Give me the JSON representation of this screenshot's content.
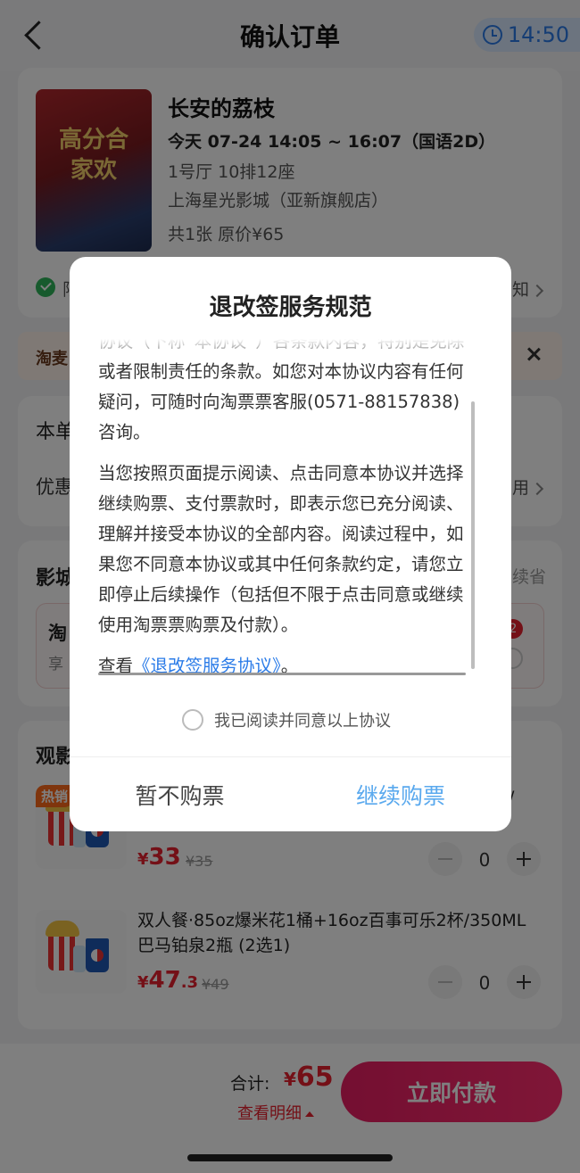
{
  "header": {
    "title": "确认订单",
    "timer": "14:50"
  },
  "movie": {
    "poster_text": "高分合家欢",
    "title": "长安的荔枝",
    "showtime": "今天 07-24 14:05 ~ 16:07（国语2D）",
    "seat": "1号厅 10排12座",
    "cinema": "上海星光影城（亚新旗舰店）",
    "ticket_summary": "共1张  原价¥65",
    "policy_left": "限",
    "policy_right": "知"
  },
  "banner": {
    "brand": "淘麦",
    "close_icon": "close-icon"
  },
  "sections": {
    "order_partial": "本单",
    "discount_partial": "优惠",
    "discount_right": "用",
    "cinema_section": "影城",
    "cinema_right": "续省",
    "taopiao_partial": "淘",
    "enjoy_partial": "享",
    "badge_count": "2",
    "viewing_partial": "观影"
  },
  "snacks": [
    {
      "tag": "热销",
      "name": "/",
      "price_currency": "¥",
      "price_int": "33",
      "price_dec": "",
      "orig_price": "¥35",
      "qty": "0"
    },
    {
      "tag": "",
      "name": "双人餐·85oz爆米花1桶+16oz百事可乐2杯/350ML巴马铂泉2瓶 (2选1)",
      "price_currency": "¥",
      "price_int": "47",
      "price_dec": ".3",
      "orig_price": "¥49",
      "qty": "0"
    }
  ],
  "bottom": {
    "total_label": "合计:",
    "total_currency": "¥",
    "total_amount": "65",
    "details": "查看明细",
    "pay_button": "立即付款"
  },
  "modal": {
    "title": "退改签服务规范",
    "paragraph1": "协议（下称“本协议”）各条款内容，特别是免除或者限制责任的条款。如您对本协议内容有任何疑问，可随时向淘票票客服(0571-88157838) 咨询。",
    "paragraph2": "当您按照页面提示阅读、点击同意本协议并选择继续购票、支付票款时，即表示您已充分阅读、理解并接受本协议的全部内容。阅读过程中，如果您不同意本协议或其中任何条款约定，请您立即停止后续操作（包括但不限于点击同意或继续使用淘票票购票及付款）。",
    "view_prefix": "查看",
    "view_link": "《退改签服务协议》",
    "view_suffix": "。",
    "agree_label": "我已阅读并同意以上协议",
    "cancel_button": "暂不购票",
    "continue_button": "继续购票"
  },
  "colors": {
    "accent_red": "#e8212f",
    "pay_gradient_start": "#e91e63",
    "link_blue": "#2a7be8",
    "continue_blue": "#5aa9ee",
    "timer_bg": "#d8e8ff"
  }
}
